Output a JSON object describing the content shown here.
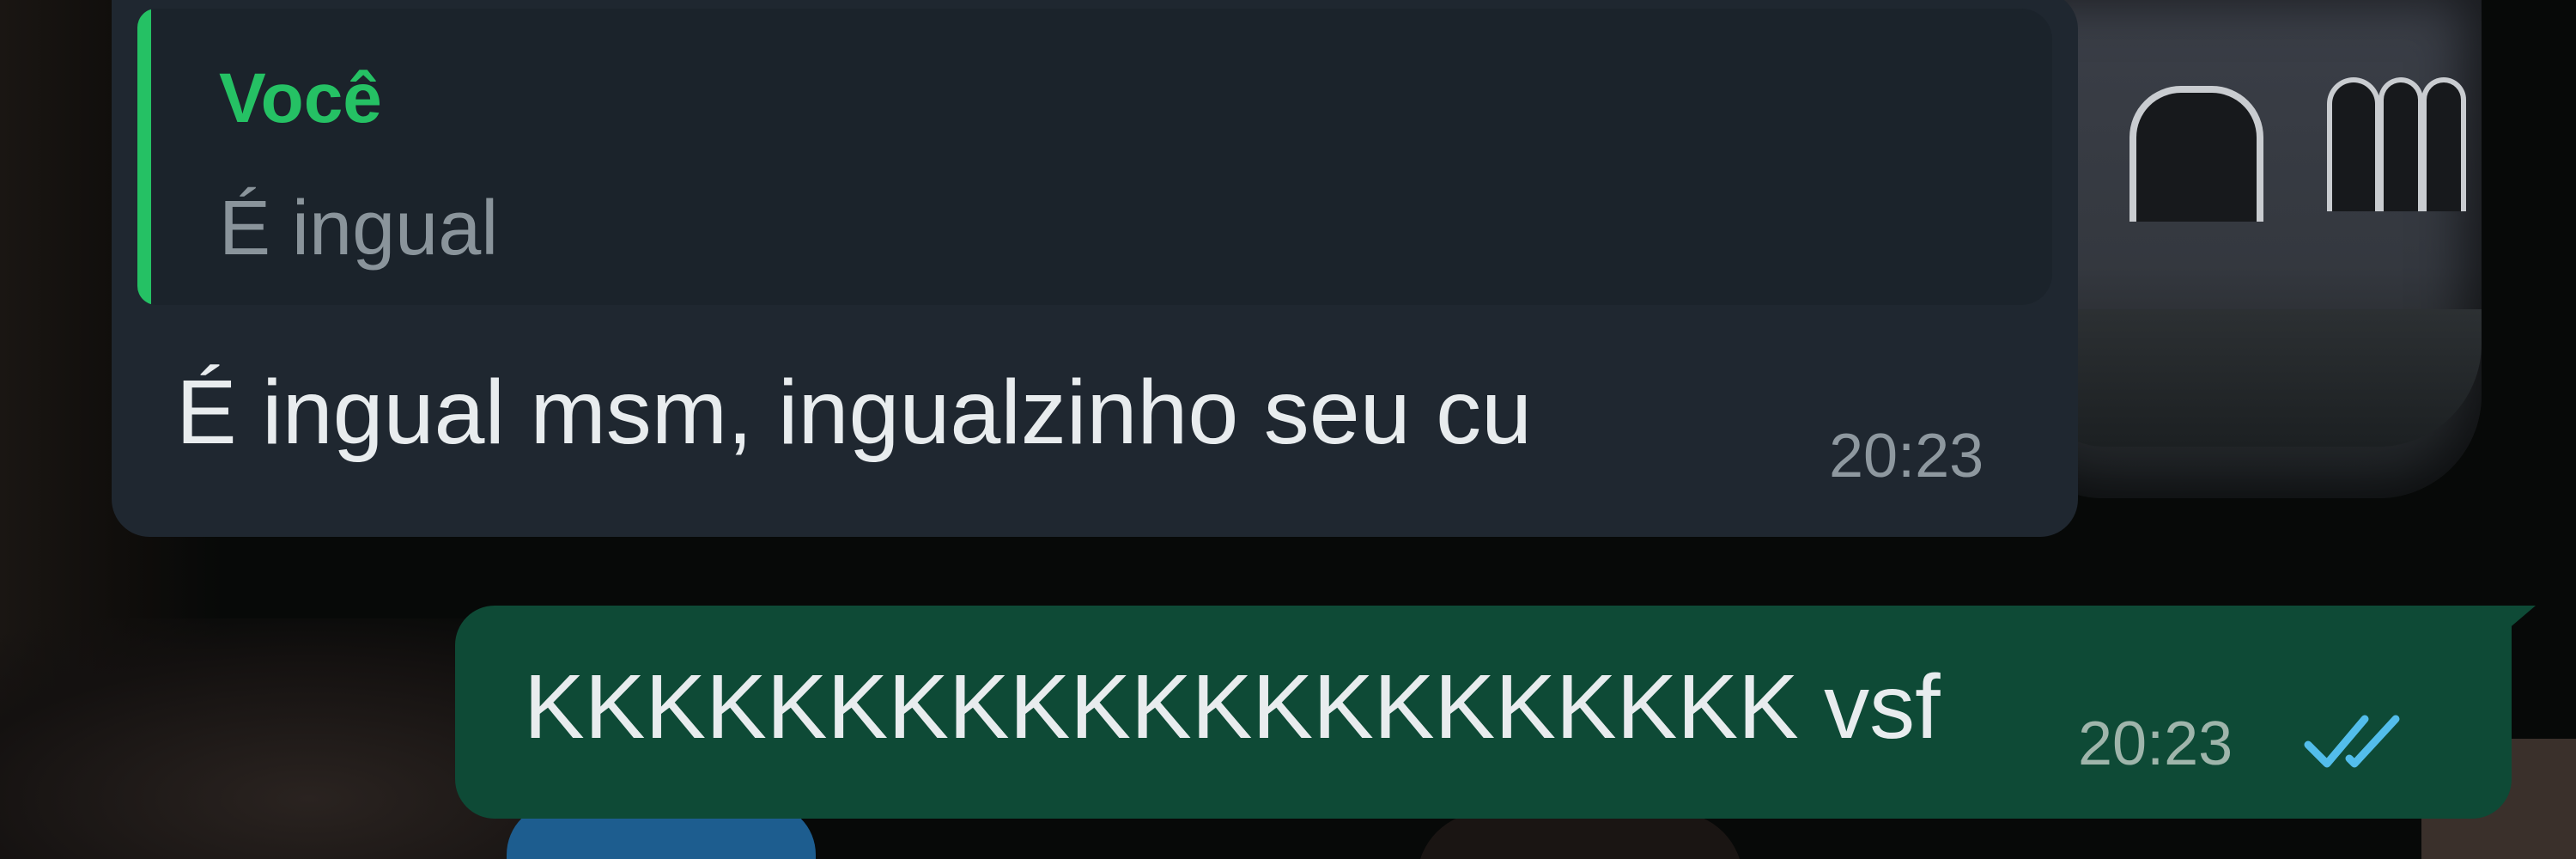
{
  "chat": {
    "incoming": {
      "reply_quote": {
        "author": "Você",
        "text": "É ingual"
      },
      "text": "É ingual msm, ingualzinho seu cu",
      "time": "20:23"
    },
    "outgoing": {
      "text": "KKKKKKKKKKKKKKKKKKKKK vsf",
      "time": "20:23",
      "status_icon": "double-check-read-icon"
    }
  },
  "colors": {
    "incoming_bubble": "#1f2730",
    "quote_background": "#1b232b",
    "quote_accent": "#25c164",
    "outgoing_bubble": "#0e4a36",
    "read_ticks": "#53bdeb",
    "message_text": "#e8ecee",
    "timestamp": "#8e989f"
  }
}
